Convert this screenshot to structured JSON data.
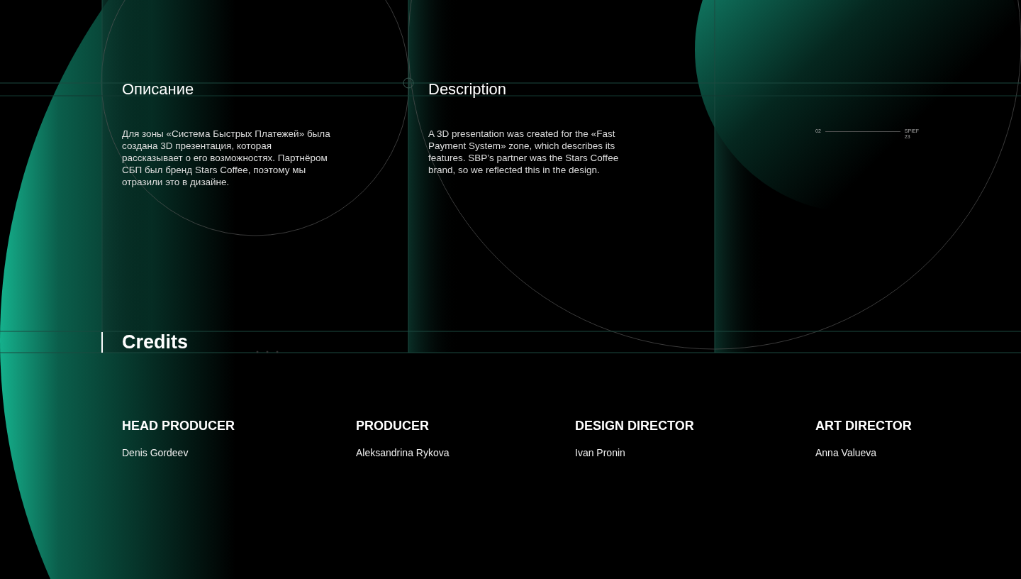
{
  "description_ru": {
    "heading": "Описание",
    "text": "Для зоны «Система Быстрых Платежей» была создана 3D презентация, которая рассказывает о его возможностях. Партнёром СБП был бренд Stars Coffee, поэтому мы отразили это в дизайне."
  },
  "description_en": {
    "heading": "Description",
    "text": "A 3D presentation was created for the «Fast Payment System» zone, which describes its features. SBP’s partner was the Stars Coffee brand, so we reflected this in the design."
  },
  "slide_label": {
    "number": "02",
    "caption": "SPIEF 23"
  },
  "credits": {
    "heading": "Credits",
    "people": [
      {
        "role": "HEAD PRODUCER",
        "name": "Denis Gordeev"
      },
      {
        "role": "PRODUCER",
        "name": "Aleksandrina Rykova"
      },
      {
        "role": "DESIGN DIRECTOR",
        "name": "Ivan Pronin"
      },
      {
        "role": "ART DIRECTOR",
        "name": "Anna Valueva"
      }
    ]
  }
}
